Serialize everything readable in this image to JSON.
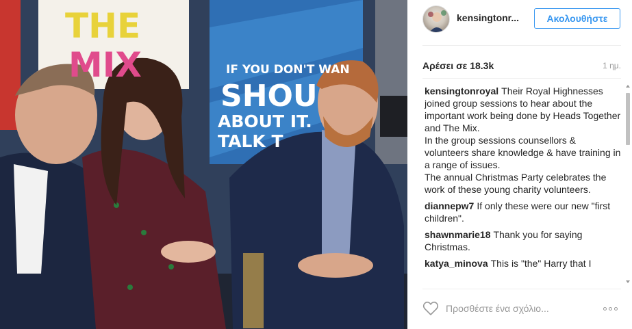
{
  "photo": {
    "poster_left_line1": "THE",
    "poster_left_line2": "MIX",
    "poster_right_line1": "IF YOU DON'T WAN",
    "poster_right_line2": "SHOU",
    "poster_right_line3": "ABOUT IT.",
    "poster_right_line4": "TALK T"
  },
  "header": {
    "username": "kensingtonr...",
    "follow_label": "Ακολουθήστε"
  },
  "stats": {
    "likes": "Αρέσει σε 18.3k",
    "time": "1 ημ."
  },
  "comments": [
    {
      "user": "kensingtonroyal",
      "text": "Their Royal Highnesses joined group sessions to hear about the important work being done by Heads Together and The Mix.\nIn the group sessions counsellors & volunteers share knowledge & have training in a range of issues.\nThe annual Christmas Party celebrates the work of these young charity volunteers."
    },
    {
      "user": "diannepw7",
      "text": "If only these were our new \"first children\"."
    },
    {
      "user": "shawnmarie18",
      "text": "Thank you for saying Christmas."
    },
    {
      "user": "katya_minova",
      "text": "This is \"the\" Harry that I"
    }
  ],
  "footer": {
    "comment_placeholder": "Προσθέστε ένα σχόλιο..."
  },
  "colors": {
    "accent": "#3897f0",
    "text": "#262626",
    "muted": "#999999"
  },
  "icons": {
    "like": "heart-outline-icon",
    "more": "ellipsis-icon"
  }
}
